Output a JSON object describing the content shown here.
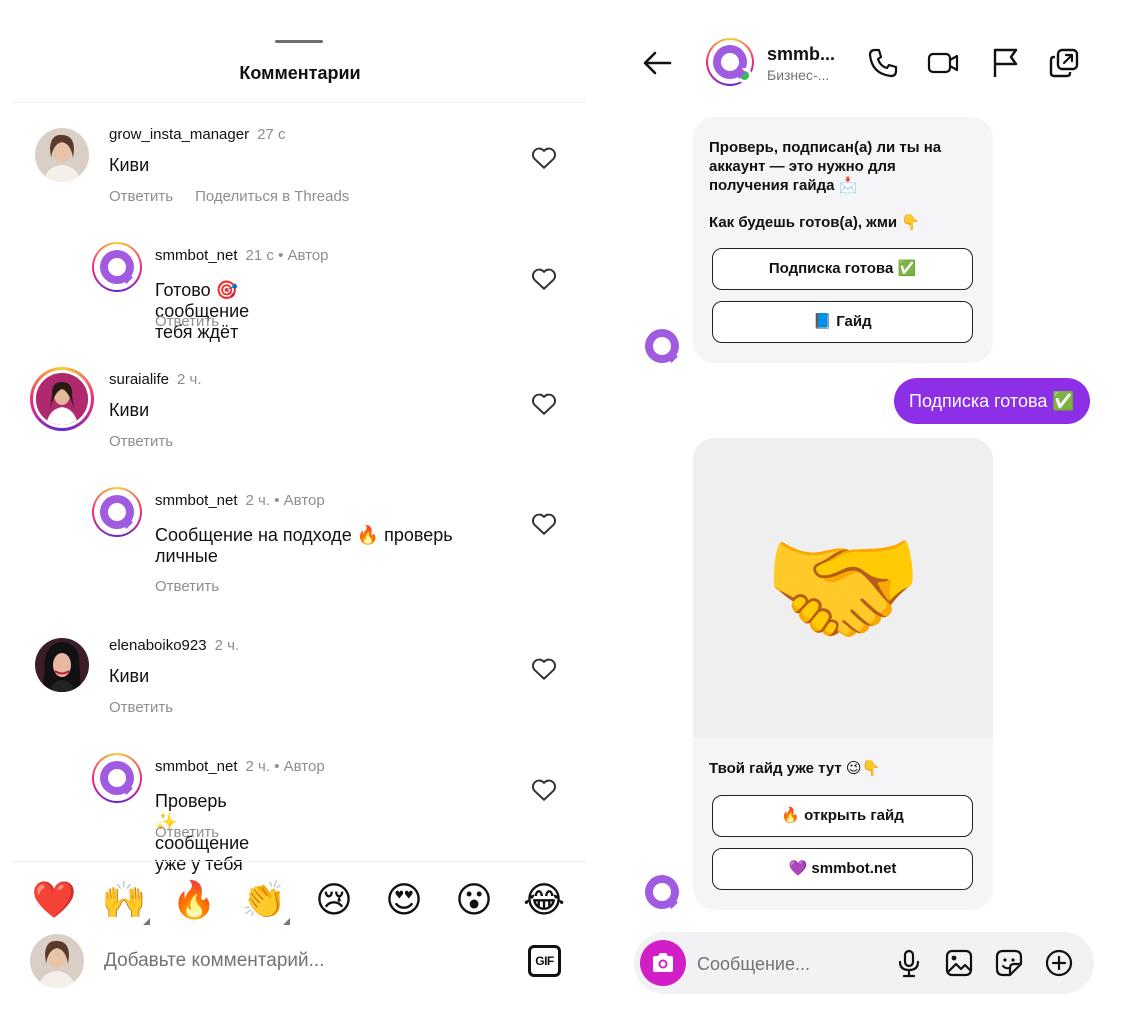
{
  "comments_panel": {
    "title": "Комментарии",
    "comments": [
      {
        "username": "grow_insta_manager",
        "time": "27 с",
        "text": "Киви",
        "actions": [
          "Ответить",
          "Поделиться в Threads"
        ]
      },
      {
        "username": "smmbot_net",
        "time": "21 с",
        "author": "• Автор",
        "text": "Готово 🎯 сообщение тебя ждёт",
        "actions": [
          "Ответить"
        ]
      },
      {
        "username": "suraialife",
        "time": "2 ч.",
        "text": "Киви",
        "actions": [
          "Ответить"
        ]
      },
      {
        "username": "smmbot_net",
        "time": "2 ч.",
        "author": "• Автор",
        "text": "Сообщение на подходе 🔥 проверь личные",
        "actions": [
          "Ответить"
        ]
      },
      {
        "username": "elenaboiko923",
        "time": "2 ч.",
        "text": "Киви",
        "actions": [
          "Ответить"
        ]
      },
      {
        "username": "smmbot_net",
        "time": "2 ч.",
        "author": "• Автор",
        "text": "Проверь ✨ сообщение уже у тебя",
        "actions": [
          "Ответить"
        ]
      }
    ],
    "emoji_bar": [
      "❤️",
      "🙌",
      "🔥",
      "👏",
      "😢",
      "😍",
      "😮",
      "😂"
    ],
    "input": {
      "placeholder": "Добавьте комментарий...",
      "gif_label": "GIF"
    }
  },
  "dm_panel": {
    "header": {
      "name": "smmb...",
      "subtitle": "Бизнес-..."
    },
    "messages": {
      "bot1_text": "Проверь, подписан(а) ли ты на аккаунт — это нужно для получения гайда 📩",
      "bot1_text2": "Как будешь готов(а), жми 👇",
      "bot1_buttons": [
        "Подписка готова ✅",
        "📘 Гайд"
      ],
      "user_reply": "Подписка готова ✅",
      "card_image_emoji": "🤝",
      "card_text": "Твой гайд уже тут 😉👇",
      "card_buttons": [
        "🔥 открыть гайд",
        "💜 smmbot.net"
      ]
    },
    "input": {
      "placeholder": "Сообщение..."
    }
  },
  "colors": {
    "accent_purple": "#8d2fe6",
    "camera_pink": "#d21ec7",
    "online_green": "#30c24a",
    "muted_text": "#8e8e8e"
  }
}
